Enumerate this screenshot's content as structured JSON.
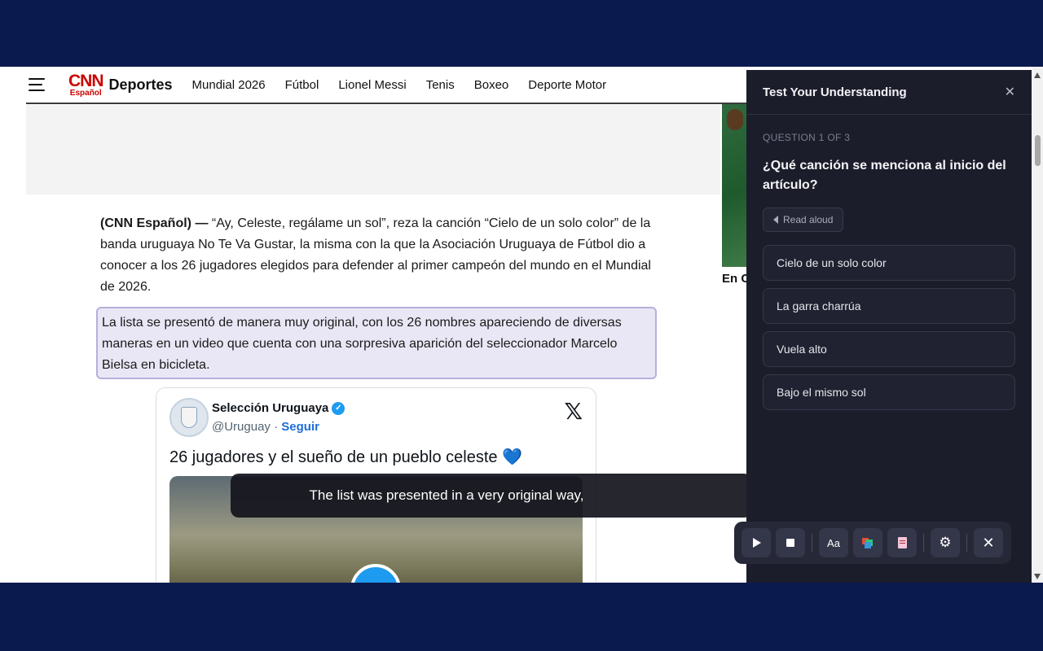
{
  "header": {
    "logo_main": "CNN",
    "logo_sub": "Español",
    "section_title": "Deportes",
    "nav": [
      "Mundial 2026",
      "Fútbol",
      "Lionel Messi",
      "Tenis",
      "Boxeo",
      "Deporte Motor"
    ]
  },
  "article": {
    "lead_source": "(CNN Español) —",
    "paragraph1": " “Ay, Celeste, regálame un sol”, reza la canción “Cielo de un solo color” de la banda uruguaya No Te Va Gustar, la misma con la que la Asociación Uruguaya de Fútbol dio a conocer a los 26 jugadores elegidos para defender al primer campeón del mundo en el Mundial de 2026.",
    "paragraph2": "La lista se presentó de manera muy original, con los 26 nombres apareciendo de diversas maneras en un video que cuenta con una sorpresiva aparición del seleccionador Marcelo Bielsa en bicicleta."
  },
  "sidebar_teaser": {
    "caption": "En C"
  },
  "tweet": {
    "name": "Selección Uruguaya",
    "handle": "@Uruguay",
    "separator": " · ",
    "follow": "Seguir",
    "text": "26 jugadores y el sueño de un pueblo celeste",
    "emoji": "💙",
    "brand_icon": "x-logo-icon"
  },
  "caption": {
    "text": "The list was presented in a very original way,"
  },
  "quiz": {
    "title": "Test Your Understanding",
    "counter": "QUESTION 1 OF 3",
    "question": "¿Qué canción se menciona al inicio del artículo?",
    "read_aloud": "Read aloud",
    "options": [
      "Cielo de un solo color",
      "La garra charrúa",
      "Vuela alto",
      "Bajo el mismo sol"
    ]
  },
  "toolbar": {
    "font_label": "Aa"
  }
}
